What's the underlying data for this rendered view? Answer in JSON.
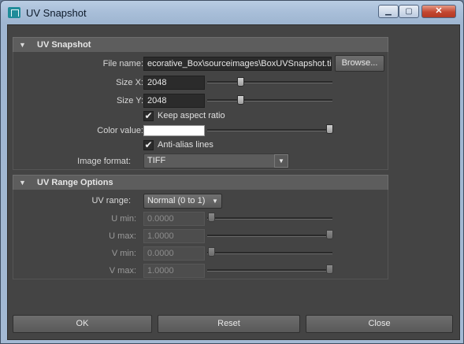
{
  "window": {
    "title": "UV Snapshot",
    "controls": {
      "minimize": "▁",
      "maximize": "▢",
      "close": "✕"
    }
  },
  "uv_snapshot": {
    "header": "UV Snapshot",
    "file_name_label": "File name:",
    "file_name_value": "ecorative_Box\\sourceimages\\BoxUVSnapshot.tif",
    "browse_label": "Browse...",
    "size_x_label": "Size X:",
    "size_x_value": "2048",
    "size_y_label": "Size Y:",
    "size_y_value": "2048",
    "keep_aspect_label": "Keep aspect ratio",
    "keep_aspect_checked": true,
    "color_value_label": "Color value:",
    "color_value": "#ffffff",
    "anti_alias_label": "Anti-alias lines",
    "anti_alias_checked": true,
    "image_format_label": "Image format:",
    "image_format_value": "TIFF"
  },
  "uv_range": {
    "header": "UV Range Options",
    "uv_range_label": "UV range:",
    "uv_range_value": "Normal (0 to 1)",
    "u_min_label": "U min:",
    "u_min_value": "0.0000",
    "u_max_label": "U max:",
    "u_max_value": "1.0000",
    "v_min_label": "V min:",
    "v_min_value": "0.0000",
    "v_max_label": "V max:",
    "v_max_value": "1.0000"
  },
  "buttons": {
    "ok": "OK",
    "reset": "Reset",
    "close": "Close"
  },
  "icons": {
    "collapse": "▼",
    "check": "✔",
    "dropdown": "▼"
  }
}
